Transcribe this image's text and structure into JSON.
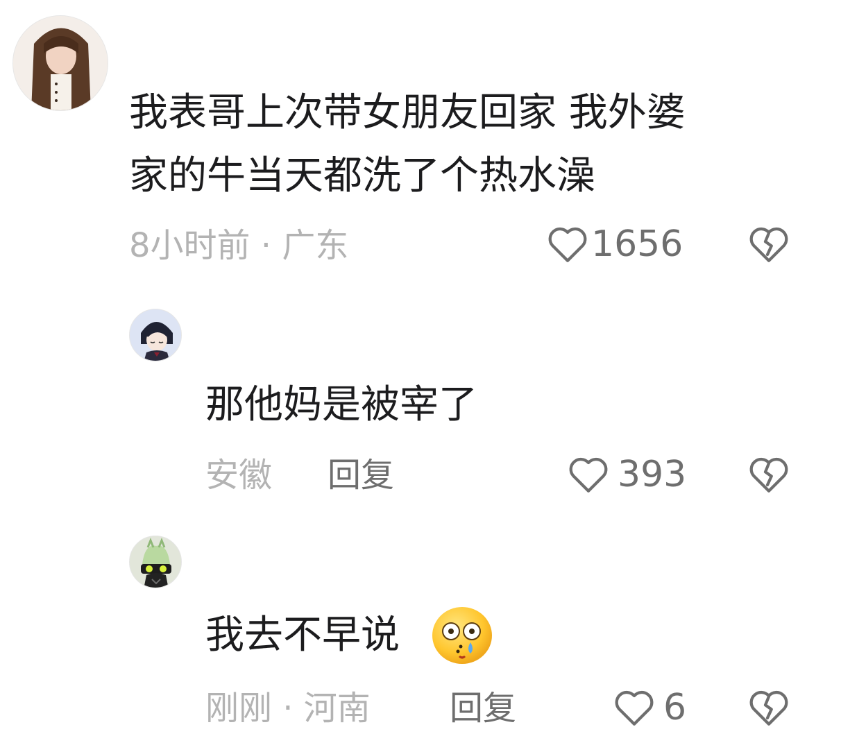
{
  "comments": [
    {
      "text_line1": "我表哥上次带女朋友回家  我外婆",
      "text_line2": "家的牛当天都洗了个热水澡",
      "meta": "8小时前 · 广东",
      "likes": "1656"
    }
  ],
  "replies": [
    {
      "text": "那他妈是被宰了",
      "location": "安徽",
      "reply_label": "回复",
      "likes": "393"
    },
    {
      "text": "我去不早说",
      "emoji": "astonished-face-with-tear-emoji",
      "meta": "刚刚 · 河南",
      "reply_label": "回复",
      "likes": "6"
    }
  ],
  "icons": {
    "like": "heart-outline-icon",
    "dislike": "broken-heart-icon"
  },
  "colors": {
    "text": "#1c1c1e",
    "meta": "#b3b3b3",
    "action": "#6e6e6e",
    "background": "#ffffff"
  }
}
